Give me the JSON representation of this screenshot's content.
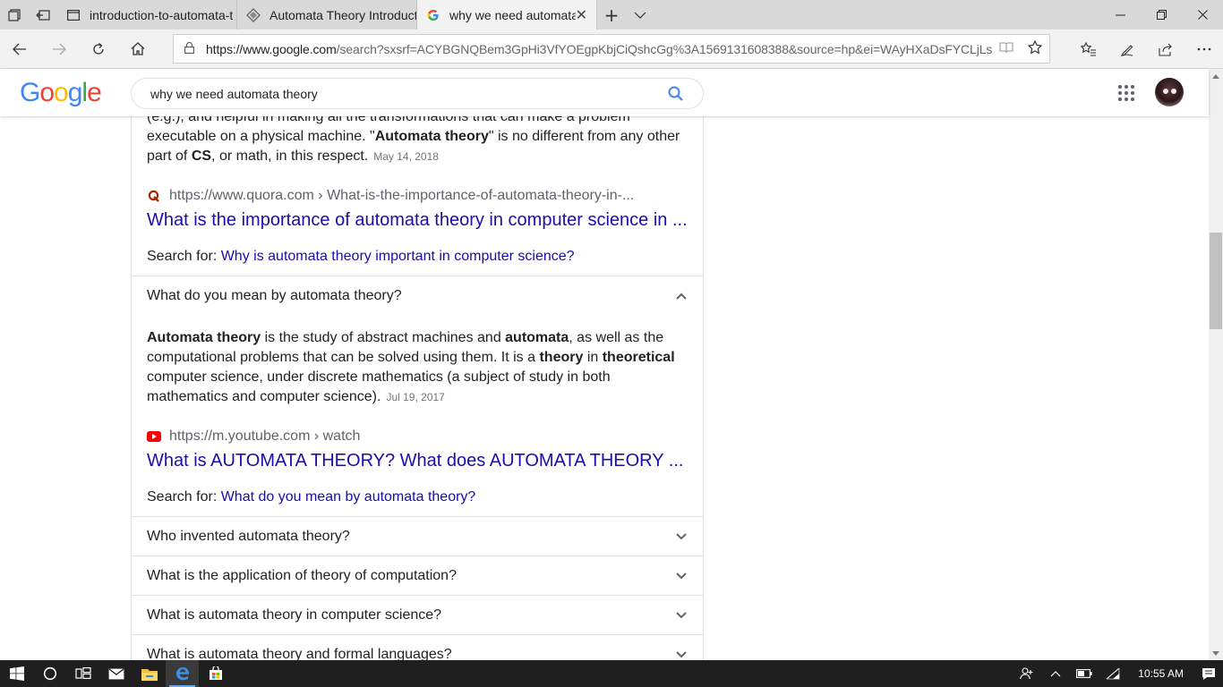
{
  "browser": {
    "tabs": [
      {
        "label": "introduction-to-automata-t",
        "icon": "page-icon",
        "active": false
      },
      {
        "label": "Automata Theory Introduct",
        "icon": "site-logo-icon",
        "active": false
      },
      {
        "label": "why we need automata",
        "icon": "google-g-icon",
        "active": true
      }
    ],
    "tab_close": "✕",
    "new_tab": "+",
    "tab_list": "⌄",
    "url_host": "https://www.google.com",
    "url_rest": "/search?sxsrf=ACYBGNQBem3GpHi3VfYOEgpKbjCiQshcGg%3A1569131608388&source=hp&ei=WAyHXaDsFYCLjLsPktyXkAU&"
  },
  "google": {
    "logo": [
      "G",
      "o",
      "o",
      "g",
      "l",
      "e"
    ],
    "logo_colors": [
      "#4285f4",
      "#ea4335",
      "#fbbc05",
      "#4285f4",
      "#34a853",
      "#ea4335"
    ],
    "query": "why we need automata theory"
  },
  "results": {
    "first": {
      "snippet_top": "(e.g.), and helpful in making all the transformations that can make a problem",
      "snippet_l2_a": "executable on a physical machine. \"",
      "snippet_l2_b": "Automata theory",
      "snippet_l2_c": "\" is no different from any other",
      "snippet_l3_a": "part of ",
      "snippet_l3_b": "CS",
      "snippet_l3_c": ", or math, in this respect.",
      "date": "May 14, 2018",
      "source": "https://www.quora.com › What-is-the-importance-of-automata-theory-in-...",
      "title": "What is the importance of automata theory in computer science in ...",
      "search_for_label": "Search for: ",
      "search_for_link": "Why is automata theory important in computer science?"
    },
    "expanded_question": "What do you mean by automata theory?",
    "second": {
      "s1": "Automata theory",
      "s2": " is the study of abstract machines and ",
      "s3": "automata",
      "s4": ", as well as the",
      "s5": "computational problems that can be solved using them. It is a ",
      "s6": "theory",
      "s7": " in ",
      "s8": "theoretical",
      "s9": "computer science, under discrete mathematics (a subject of study in both",
      "s10": "mathematics and computer science).",
      "date": "Jul 19, 2017",
      "source": "https://m.youtube.com › watch",
      "title": "What is AUTOMATA THEORY? What does AUTOMATA THEORY ...",
      "search_for_label": "Search for: ",
      "search_for_link": "What do you mean by automata theory?"
    },
    "questions": [
      "Who invented automata theory?",
      "What is the application of theory of computation?",
      "What is automata theory in computer science?",
      "What is automata theory and formal languages?"
    ]
  },
  "taskbar": {
    "time": "10:55 AM"
  }
}
